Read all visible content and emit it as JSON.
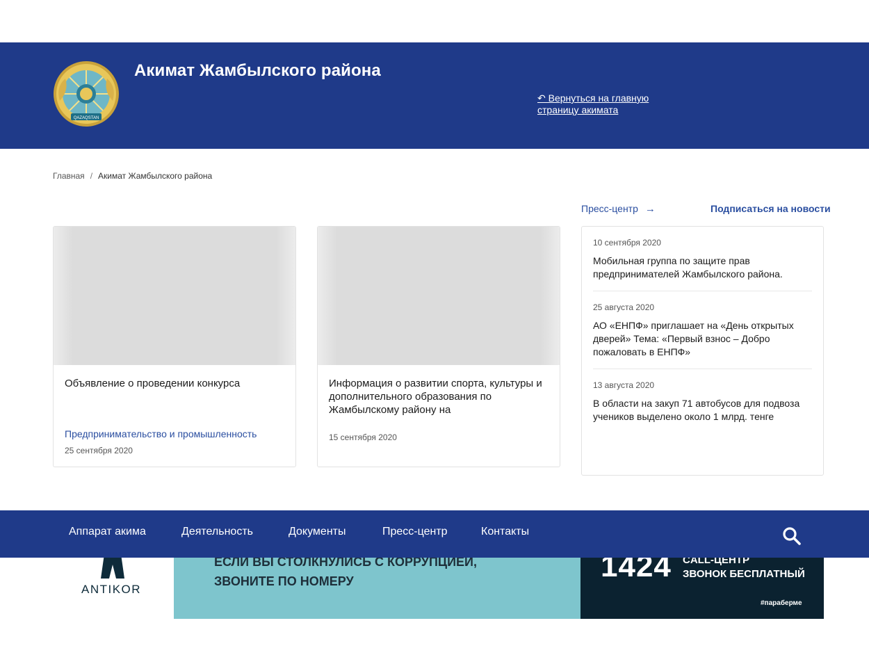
{
  "header": {
    "title": "Акимат Жамбылского района",
    "back_link": "↶ Вернуться на главную страницу акимата",
    "emblem_icon": "kazakhstan-state-emblem",
    "emblem_text": "QAZAQSTAN",
    "bg_color": "#1f3a89"
  },
  "breadcrumb": {
    "home": "Главная",
    "separator": "/",
    "current": "Акимат Жамбылского района"
  },
  "links": {
    "press_center": "Пресс-центр",
    "press_center_arrow": "→",
    "subscribe": "Подписаться на новости"
  },
  "cards": [
    {
      "title": "Объявление о проведении конкурса",
      "category": "Предпринимательство и промышленность",
      "date": "25 сентября 2020"
    },
    {
      "title": "Информация о развитии спорта, культуры и дополнительного образования по Жамбылскому району на",
      "category": "",
      "date": "15 сентября 2020"
    }
  ],
  "news": [
    {
      "date": "10 сентября 2020",
      "title": "Мобильная группа по защите прав предпринимателей Жамбылского района."
    },
    {
      "date": "25 августа 2020",
      "title": "АО «ЕНПФ» приглашает на «День открытых дверей» Тема: «Первый взнос – Добро пожаловать в ЕНПФ»"
    },
    {
      "date": "13 августа 2020",
      "title": "В области на закуп 71 автобусов для подвоза учеников выделено около 1 млрд. тенге"
    }
  ],
  "nav": {
    "items": [
      "Аппарат акима",
      "Деятельность",
      "Документы",
      "Пресс-центр",
      "Контакты"
    ],
    "search_icon": "search-icon"
  },
  "banner": {
    "logo_text": "ANTIKOR",
    "message_line1": "ЕСЛИ ВЫ СТОЛКНУЛИСЬ С КОРРУПЦИЕЙ,",
    "message_line2": "ЗВОНИТЕ ПО НОМЕРУ",
    "phone": "1424",
    "call_line1": "CALL-ЦЕНТР",
    "call_line2": "ЗВОНОК БЕСПЛАТНЫЙ",
    "hashtag": "#параберме",
    "colors": {
      "mid": "#7ec5cd",
      "right": "#0b2230"
    }
  }
}
